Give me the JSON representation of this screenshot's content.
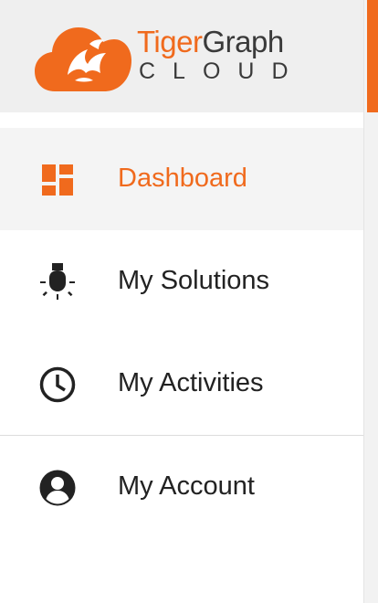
{
  "brand": {
    "name_part1": "Tiger",
    "name_part2": "Graph",
    "tagline": "CLOUD",
    "accent_color": "#f06a1d",
    "logo_icon": "tiger-cloud-logo-icon"
  },
  "nav": {
    "active_index": 0,
    "items": [
      {
        "label": "Dashboard",
        "icon": "dashboard-icon",
        "active": true
      },
      {
        "label": "My Solutions",
        "icon": "lightbulb-icon",
        "active": false
      },
      {
        "label": "My Activities",
        "icon": "clock-icon",
        "active": false
      },
      {
        "label": "My Account",
        "icon": "account-circle-icon",
        "active": false
      }
    ]
  },
  "colors": {
    "active_text": "#f06a1d",
    "text": "#222222",
    "header_bg": "#efefef",
    "active_bg": "#f4f4f4"
  }
}
